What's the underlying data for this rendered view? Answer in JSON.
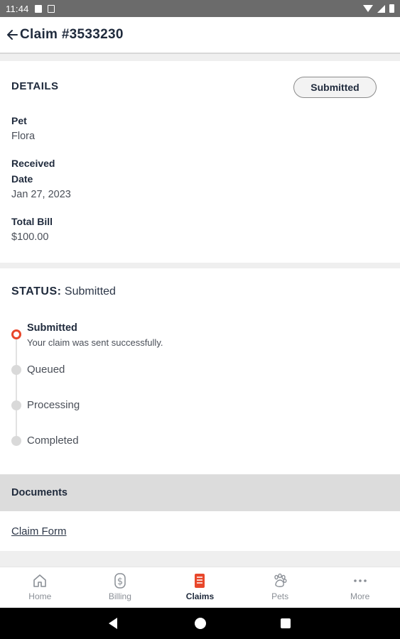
{
  "status_bar": {
    "time": "11:44"
  },
  "app_bar": {
    "title": "Claim #3533230"
  },
  "details": {
    "section_title": "DETAILS",
    "badge": "Submitted",
    "fields": [
      {
        "label": "Pet",
        "value": "Flora"
      },
      {
        "label_line1": "Received",
        "label_line2": "Date",
        "value": "Jan 27, 2023"
      },
      {
        "label": "Total Bill",
        "value": "$100.00"
      }
    ]
  },
  "status": {
    "heading_label": "STATUS:",
    "heading_value": "Submitted",
    "steps": [
      {
        "label": "Submitted",
        "subtext": "Your claim was sent successfully.",
        "active": true
      },
      {
        "label": "Queued",
        "active": false
      },
      {
        "label": "Processing",
        "active": false
      },
      {
        "label": "Completed",
        "active": false
      }
    ]
  },
  "documents": {
    "header": "Documents",
    "items": [
      "Claim Form"
    ]
  },
  "bottom_nav": {
    "items": [
      {
        "label": "Home",
        "icon": "home-icon"
      },
      {
        "label": "Billing",
        "icon": "dollar-icon"
      },
      {
        "label": "Claims",
        "icon": "claims-document-icon",
        "active": true
      },
      {
        "label": "Pets",
        "icon": "paw-icon"
      },
      {
        "label": "More",
        "icon": "more-dots-icon"
      }
    ]
  },
  "colors": {
    "accent": "#e8472b",
    "text_dark": "#1f2a3c",
    "divider": "#efefef"
  }
}
